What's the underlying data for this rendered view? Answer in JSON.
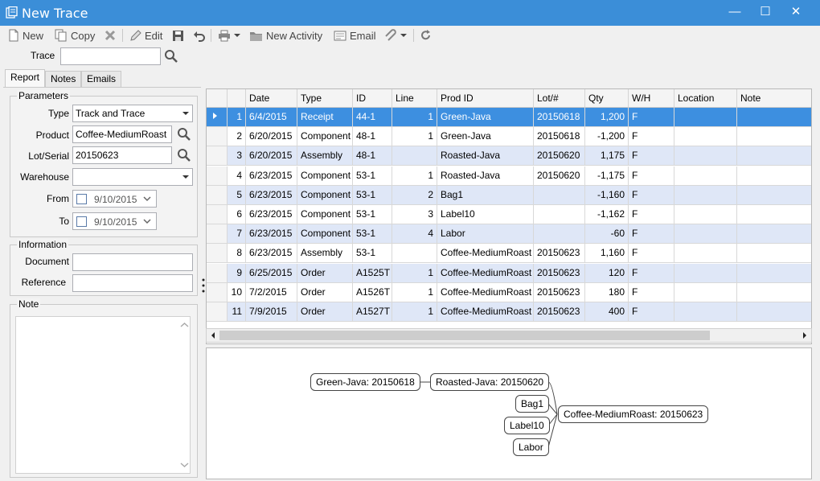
{
  "window": {
    "title": "New Trace"
  },
  "toolbar": {
    "new": "New",
    "copy": "Copy",
    "edit": "Edit",
    "new_activity": "New Activity",
    "email": "Email"
  },
  "trace": {
    "label": "Trace",
    "value": ""
  },
  "tabs": [
    "Report",
    "Notes",
    "Emails"
  ],
  "parameters": {
    "title": "Parameters",
    "type_label": "Type",
    "type_value": "Track and Trace",
    "product_label": "Product",
    "product_value": "Coffee-MediumRoast",
    "lot_label": "Lot/Serial",
    "lot_value": "20150623",
    "warehouse_label": "Warehouse",
    "warehouse_value": "",
    "from_label": "From",
    "from_value": "9/10/2015",
    "to_label": "To",
    "to_value": "9/10/2015"
  },
  "information": {
    "title": "Information",
    "document_label": "Document",
    "document_value": "",
    "reference_label": "Reference",
    "reference_value": ""
  },
  "note": {
    "title": "Note"
  },
  "grid": {
    "columns": [
      "",
      "",
      "Date",
      "Type",
      "ID",
      "Line",
      "Prod ID",
      "Lot/#",
      "Qty",
      "W/H",
      "Location",
      "Note"
    ],
    "rows": [
      [
        "1",
        "6/4/2015",
        "Receipt",
        "44-1",
        "1",
        "Green-Java",
        "20150618",
        "1,200",
        "F",
        "",
        ""
      ],
      [
        "2",
        "6/20/2015",
        "Component",
        "48-1",
        "1",
        "Green-Java",
        "20150618",
        "-1,200",
        "F",
        "",
        ""
      ],
      [
        "3",
        "6/20/2015",
        "Assembly",
        "48-1",
        "",
        "Roasted-Java",
        "20150620",
        "1,175",
        "F",
        "",
        ""
      ],
      [
        "4",
        "6/23/2015",
        "Component",
        "53-1",
        "1",
        "Roasted-Java",
        "20150620",
        "-1,175",
        "F",
        "",
        ""
      ],
      [
        "5",
        "6/23/2015",
        "Component",
        "53-1",
        "2",
        "Bag1",
        "",
        "-1,160",
        "F",
        "",
        ""
      ],
      [
        "6",
        "6/23/2015",
        "Component",
        "53-1",
        "3",
        "Label10",
        "",
        "-1,162",
        "F",
        "",
        ""
      ],
      [
        "7",
        "6/23/2015",
        "Component",
        "53-1",
        "4",
        "Labor",
        "",
        "-60",
        "F",
        "",
        ""
      ],
      [
        "8",
        "6/23/2015",
        "Assembly",
        "53-1",
        "",
        "Coffee-MediumRoast",
        "20150623",
        "1,160",
        "F",
        "",
        ""
      ],
      [
        "9",
        "6/25/2015",
        "Order",
        "A1525T",
        "1",
        "Coffee-MediumRoast",
        "20150623",
        "120",
        "F",
        "",
        ""
      ],
      [
        "10",
        "7/2/2015",
        "Order",
        "A1526T",
        "1",
        "Coffee-MediumRoast",
        "20150623",
        "180",
        "F",
        "",
        ""
      ],
      [
        "11",
        "7/9/2015",
        "Order",
        "A1527T",
        "1",
        "Coffee-MediumRoast",
        "20150623",
        "400",
        "F",
        "",
        ""
      ]
    ]
  },
  "diagram": {
    "nodes": {
      "green_java": "Green-Java: 20150618",
      "roasted_java": "Roasted-Java: 20150620",
      "bag1": "Bag1",
      "label10": "Label10",
      "labor": "Labor",
      "coffee": "Coffee-MediumRoast: 20150623"
    }
  }
}
